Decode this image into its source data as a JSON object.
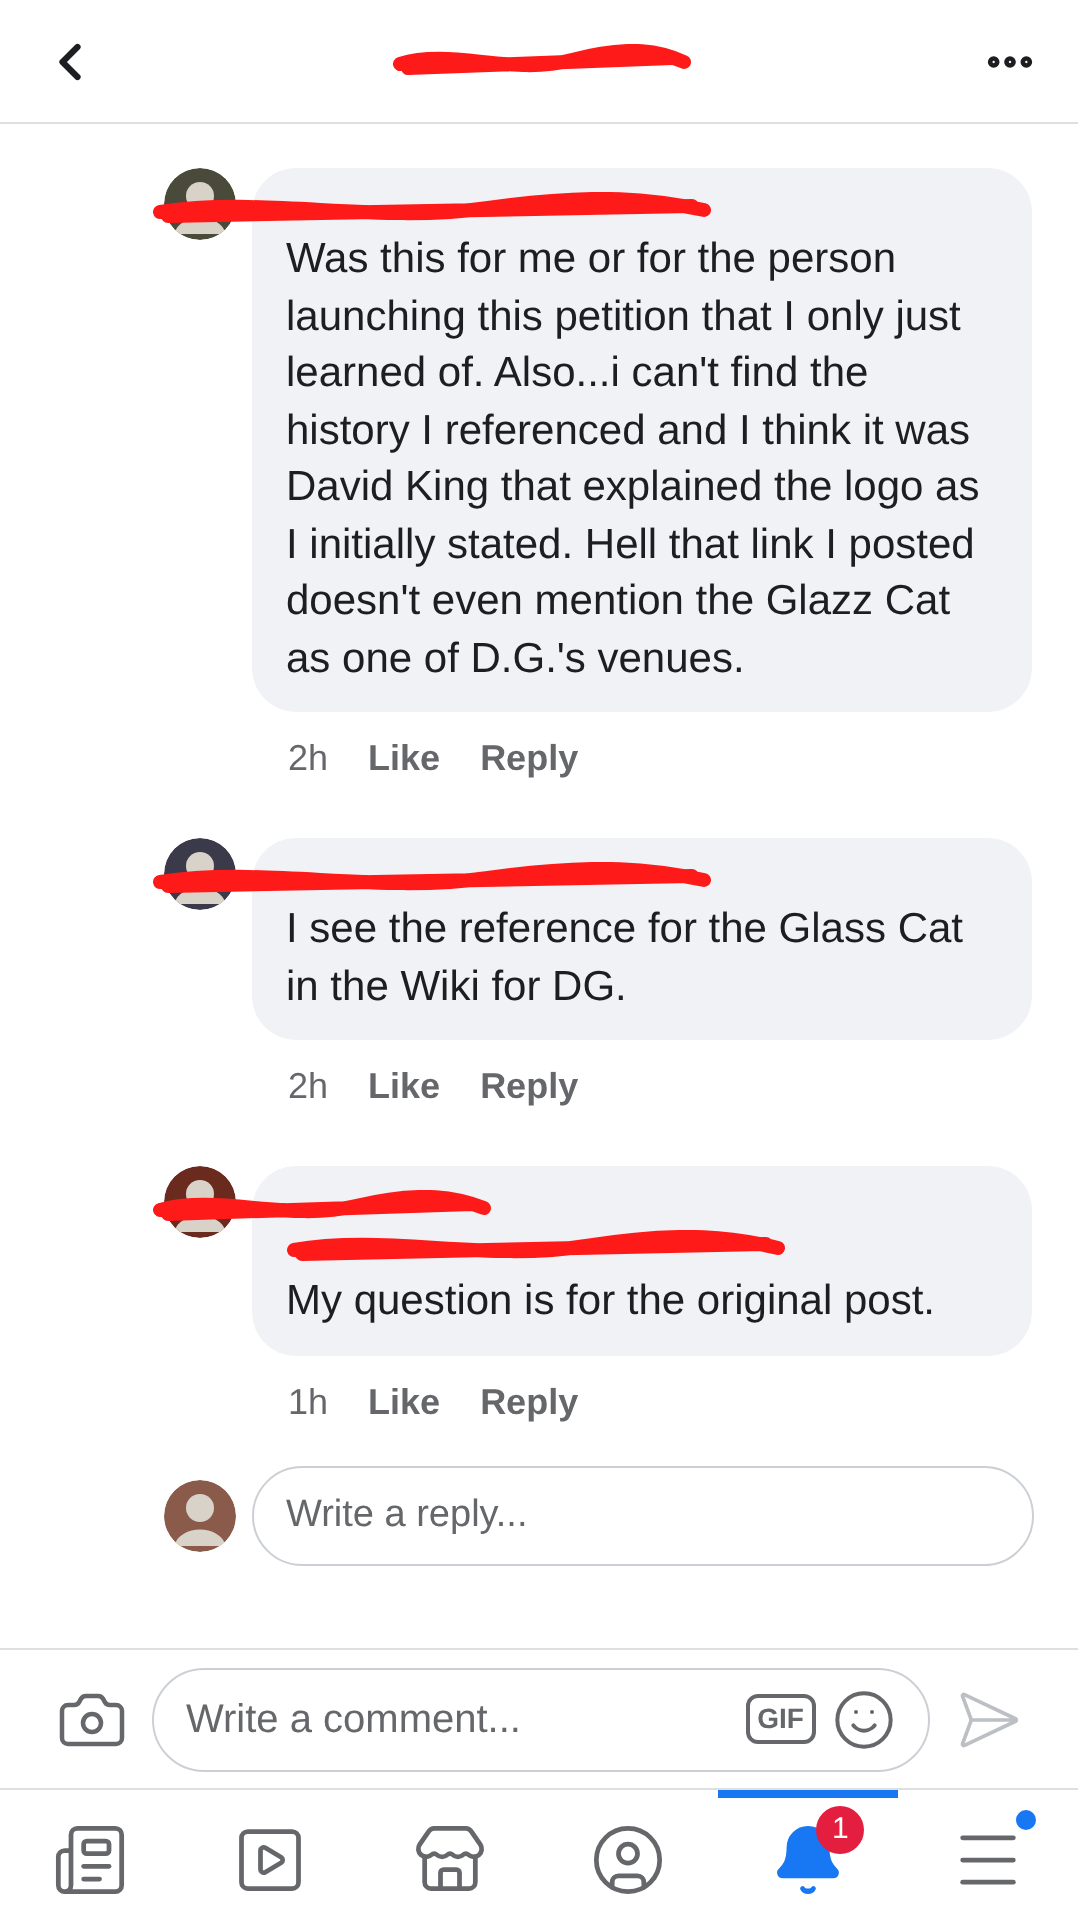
{
  "header": {
    "title_redacted": true
  },
  "comments": [
    {
      "text": "Was this for me or for the person launching this petition that I only just learned of.  Also...i can't find the history I referenced and I think it was David King that explained the logo as I initially stated.  Hell that link I posted doesn't even mention the Glazz Cat as one of D.G.'s venues.",
      "time": "2h",
      "like": "Like",
      "reply": "Reply",
      "mention_redacted": false
    },
    {
      "text": "I see the reference for the Glass Cat in the Wiki for DG.",
      "time": "2h",
      "like": "Like",
      "reply": "Reply",
      "mention_redacted": false
    },
    {
      "text": "My question is for the original post.",
      "time": "1h",
      "like": "Like",
      "reply": "Reply",
      "mention_redacted": true
    }
  ],
  "reply_field": {
    "placeholder": "Write a reply..."
  },
  "comment_bar": {
    "placeholder": "Write a comment...",
    "gif_label": "GIF"
  },
  "nav": [
    {
      "kind": "feed",
      "selected": false,
      "dot": false
    },
    {
      "kind": "video",
      "selected": false,
      "dot": false
    },
    {
      "kind": "shop",
      "selected": false,
      "dot": false
    },
    {
      "kind": "profile",
      "selected": false,
      "dot": false
    },
    {
      "kind": "notifications",
      "selected": true,
      "dot": false,
      "badge": "1"
    },
    {
      "kind": "menu",
      "selected": false,
      "dot": true
    }
  ]
}
